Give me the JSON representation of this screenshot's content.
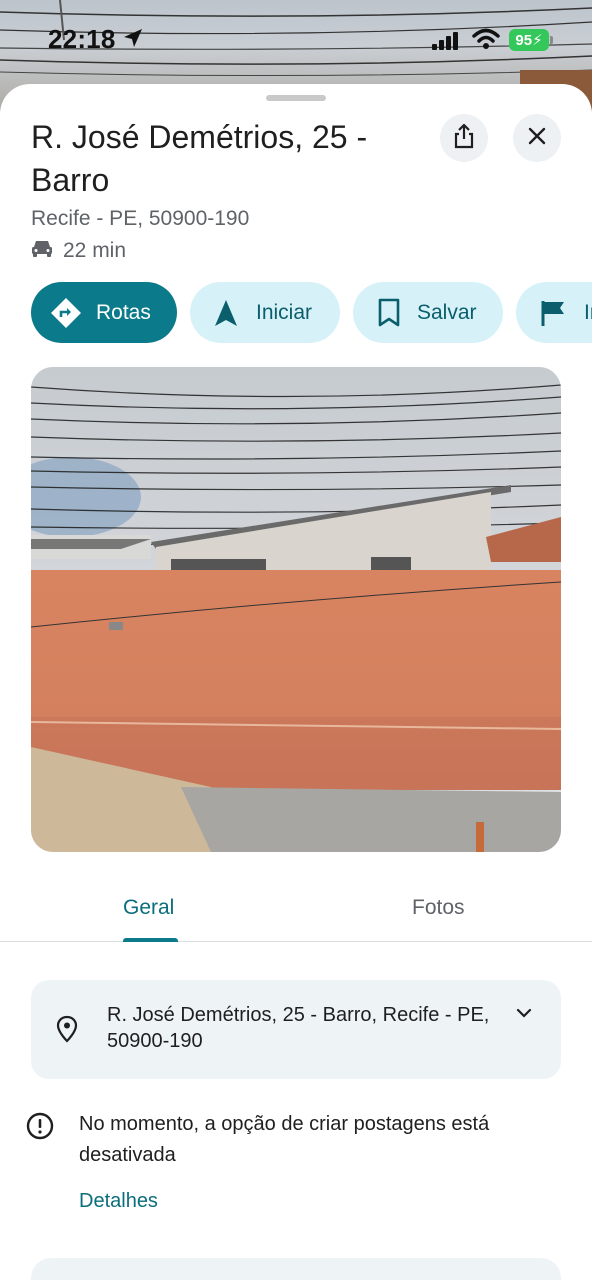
{
  "status_bar": {
    "time": "22:18",
    "battery": "95"
  },
  "place": {
    "title": "R. José Demétrios, 25 - Barro",
    "subtitle": "Recife - PE, 50900-190",
    "drive_time": "22 min"
  },
  "actions": [
    {
      "label": "Rotas",
      "icon": "directions-icon"
    },
    {
      "label": "Iniciar",
      "icon": "navigation-arrow-icon"
    },
    {
      "label": "Salvar",
      "icon": "bookmark-icon"
    },
    {
      "label": "Ir",
      "icon": "flag-icon"
    }
  ],
  "photo": {
    "description_icon": "street-view-photo"
  },
  "tabs": [
    {
      "label": "Geral",
      "active": true
    },
    {
      "label": "Fotos",
      "active": false
    }
  ],
  "address_card": {
    "full_address": "R. José Demétrios, 25 - Barro, Recife - PE, 50900-190"
  },
  "notice": {
    "text": "No momento, a opção de criar postagens está desativada",
    "link": "Detalhes"
  },
  "colors": {
    "accent": "#0b7a8a",
    "chip_bg": "#d6f2f8",
    "battery": "#34c759"
  }
}
